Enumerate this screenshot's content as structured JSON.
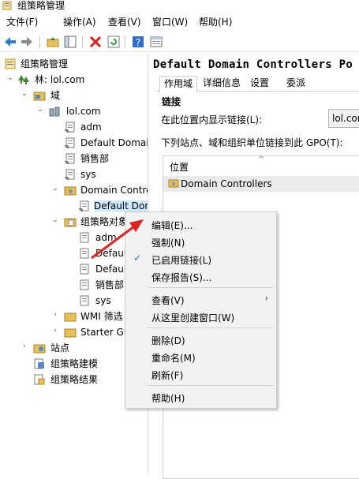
{
  "window": {
    "title": "组策略管理"
  },
  "menubar": [
    {
      "label": "文件(F)"
    },
    {
      "label": "操作(A)"
    },
    {
      "label": "查看(V)"
    },
    {
      "label": "窗口(W)"
    },
    {
      "label": "帮助(H)"
    }
  ],
  "tree": {
    "root": "组策略管理",
    "forest": "林: lol.com",
    "domains": "域",
    "domain": "lol.com",
    "domain_children": [
      "adm",
      "Default Domai",
      "销售部",
      "sys"
    ],
    "ou": "Domain Contro",
    "ou_child": "Default Dom",
    "gpo_container": "组策略对象",
    "gpos": [
      "adm",
      "Defaul",
      "Defaul",
      "销售部",
      "sys"
    ],
    "wmi": "WMI 筛选",
    "starter": "Starter GP",
    "sites": "站点",
    "modeling": "组策略建模",
    "results": "组策略结果"
  },
  "right": {
    "gpo_title": "Default Domain Controllers Po",
    "tabs": [
      "作用域",
      "详细信息",
      "设置",
      "委派"
    ],
    "section": "链接",
    "display_label": "在此位置内显示链接(L):",
    "display_value": "lol.com",
    "links_label": "下列站点、域和组织单位链接到此 GPO(T):",
    "column_location": "位置",
    "link_row": "Domain Controllers"
  },
  "context_menu": {
    "items": [
      {
        "label": "编辑(E)..."
      },
      {
        "label": "强制(N)"
      },
      {
        "label": "已启用链接(L)",
        "checked": true
      },
      {
        "label": "保存报告(S)..."
      },
      {
        "label": "查看(V)",
        "submenu": true
      },
      {
        "label": "从这里创建窗口(W)"
      },
      {
        "label": "删除(D)"
      },
      {
        "label": "重命名(M)"
      },
      {
        "label": "刷新(F)"
      },
      {
        "label": "帮助(H)"
      }
    ],
    "check_glyph": "✓",
    "submenu_glyph": "›"
  },
  "colors": {
    "arrow": "#e02020",
    "selection": "#cce8ff",
    "check": "#1f6fd6"
  }
}
